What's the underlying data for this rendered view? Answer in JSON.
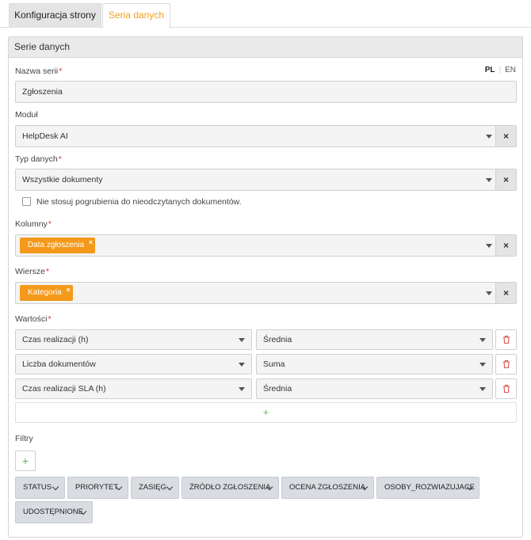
{
  "tabs": [
    {
      "label": "Konfiguracja strony",
      "active": false
    },
    {
      "label": "Seria danych",
      "active": true
    }
  ],
  "panel": {
    "title": "Serie danych"
  },
  "series_name": {
    "label": "Nazwa serii",
    "value": "Zgłoszenia",
    "languages": [
      "PL",
      "EN"
    ],
    "active_language": "PL"
  },
  "module": {
    "label": "Moduł",
    "value": "HelpDesk AI",
    "clear_icon": "close-icon"
  },
  "data_type": {
    "label": "Typ danych",
    "value": "Wszystkie dokumenty",
    "clear_icon": "close-icon"
  },
  "no_bold_checkbox": {
    "label": "Nie stosuj pogrubienia do nieodczytanych dokumentów.",
    "checked": false
  },
  "columns": {
    "label": "Kolumny",
    "tags": [
      "Data zgłoszenia"
    ]
  },
  "rows": {
    "label": "Wiersze",
    "tags": [
      "Kategoria"
    ]
  },
  "values": {
    "label": "Wartości",
    "items": [
      {
        "field": "Czas realizacji (h)",
        "aggregation": "Średnia"
      },
      {
        "field": "Liczba dokumentów",
        "aggregation": "Suma"
      },
      {
        "field": "Czas realizacji SLA (h)",
        "aggregation": "Średnia"
      }
    ],
    "add_symbol": "+"
  },
  "filters": {
    "label": "Filtry",
    "add_symbol": "+",
    "buttons": [
      "STATUS",
      "PRIORYTET",
      "ZASIĘG",
      "ŹRÓDŁO ZGŁOSZENIA",
      "OCENA ZGŁOSZENIA",
      "OSOBY_ROZWIAZUJACE",
      "UDOSTĘPNIONE"
    ]
  },
  "colors": {
    "accent": "#f4991a",
    "required": "#e0302f",
    "add": "#5cb85c",
    "delete": "#d9534f"
  }
}
